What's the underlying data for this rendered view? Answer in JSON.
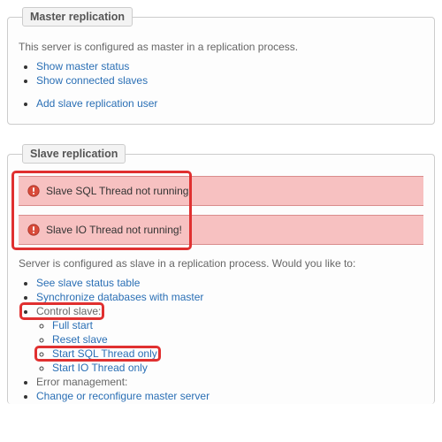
{
  "master": {
    "legend": "Master replication",
    "intro": "This server is configured as master in a replication process.",
    "links": {
      "show_status": "Show master status",
      "show_slaves": "Show connected slaves",
      "add_slave_user": "Add slave replication user"
    }
  },
  "slave": {
    "legend": "Slave replication",
    "alerts": {
      "sql_thread": "Slave SQL Thread not running!",
      "io_thread": "Slave IO Thread not running!"
    },
    "intro": "Server is configured as slave in a replication process. Would you like to:",
    "links": {
      "see_status": "See slave status table",
      "sync_db": "Synchronize databases with master",
      "control_label": "Control slave:",
      "full_start": "Full start",
      "reset_slave": "Reset slave",
      "start_sql_only": "Start SQL Thread only",
      "start_io_only": "Start IO Thread only",
      "error_mgmt_label": "Error management:",
      "change_master": "Change or reconfigure master server"
    }
  }
}
